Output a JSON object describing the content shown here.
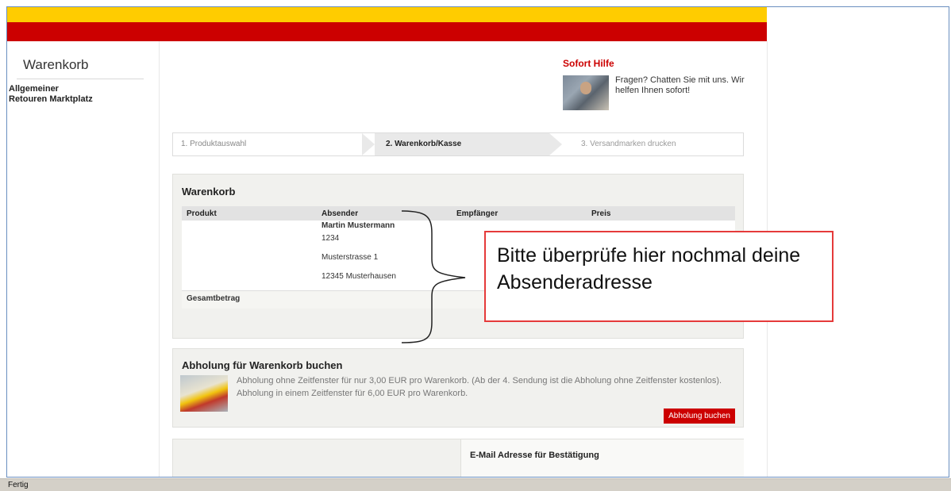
{
  "sidebar": {
    "title": "Warenkorb",
    "link": "Allgemeiner\nRetouren Marktplatz"
  },
  "help": {
    "title": "Sofort Hilfe",
    "text": "Fragen? Chatten Sie mit uns. Wir helfen Ihnen sofort!"
  },
  "steps": {
    "step1": "1. Produktauswahl",
    "step2": "2. Warenkorb/Kasse",
    "step3": "3. Versandmarken drucken"
  },
  "cart": {
    "title": "Warenkorb",
    "columns": [
      "Produkt",
      "Absender",
      "Empfänger",
      "Preis"
    ],
    "sender": {
      "name": "Martin Mustermann",
      "number": "1234",
      "street": "Musterstrasse 1",
      "city": "12345 Musterhausen"
    },
    "total_label": "Gesamtbetrag"
  },
  "callout": {
    "text": "Bitte überprüfe hier nochmal deine Absenderadresse"
  },
  "pickup": {
    "title": "Abholung für Warenkorb buchen",
    "description": "Abholung ohne Zeitfenster für nur 3,00 EUR pro Warenkorb. (Ab der 4. Sendung ist die Abholung ohne Zeitfenster kostenlos). Abholung in einem Zeitfenster für 6,00 EUR pro Warenkorb.",
    "button": "Abholung buchen"
  },
  "email": {
    "label": "E-Mail Adresse für Bestätigung",
    "value": ""
  },
  "status": {
    "text": "Fertig"
  },
  "colors": {
    "brand_yellow": "#ffcc00",
    "brand_red": "#cc0000",
    "callout_border": "#e53a3a"
  }
}
